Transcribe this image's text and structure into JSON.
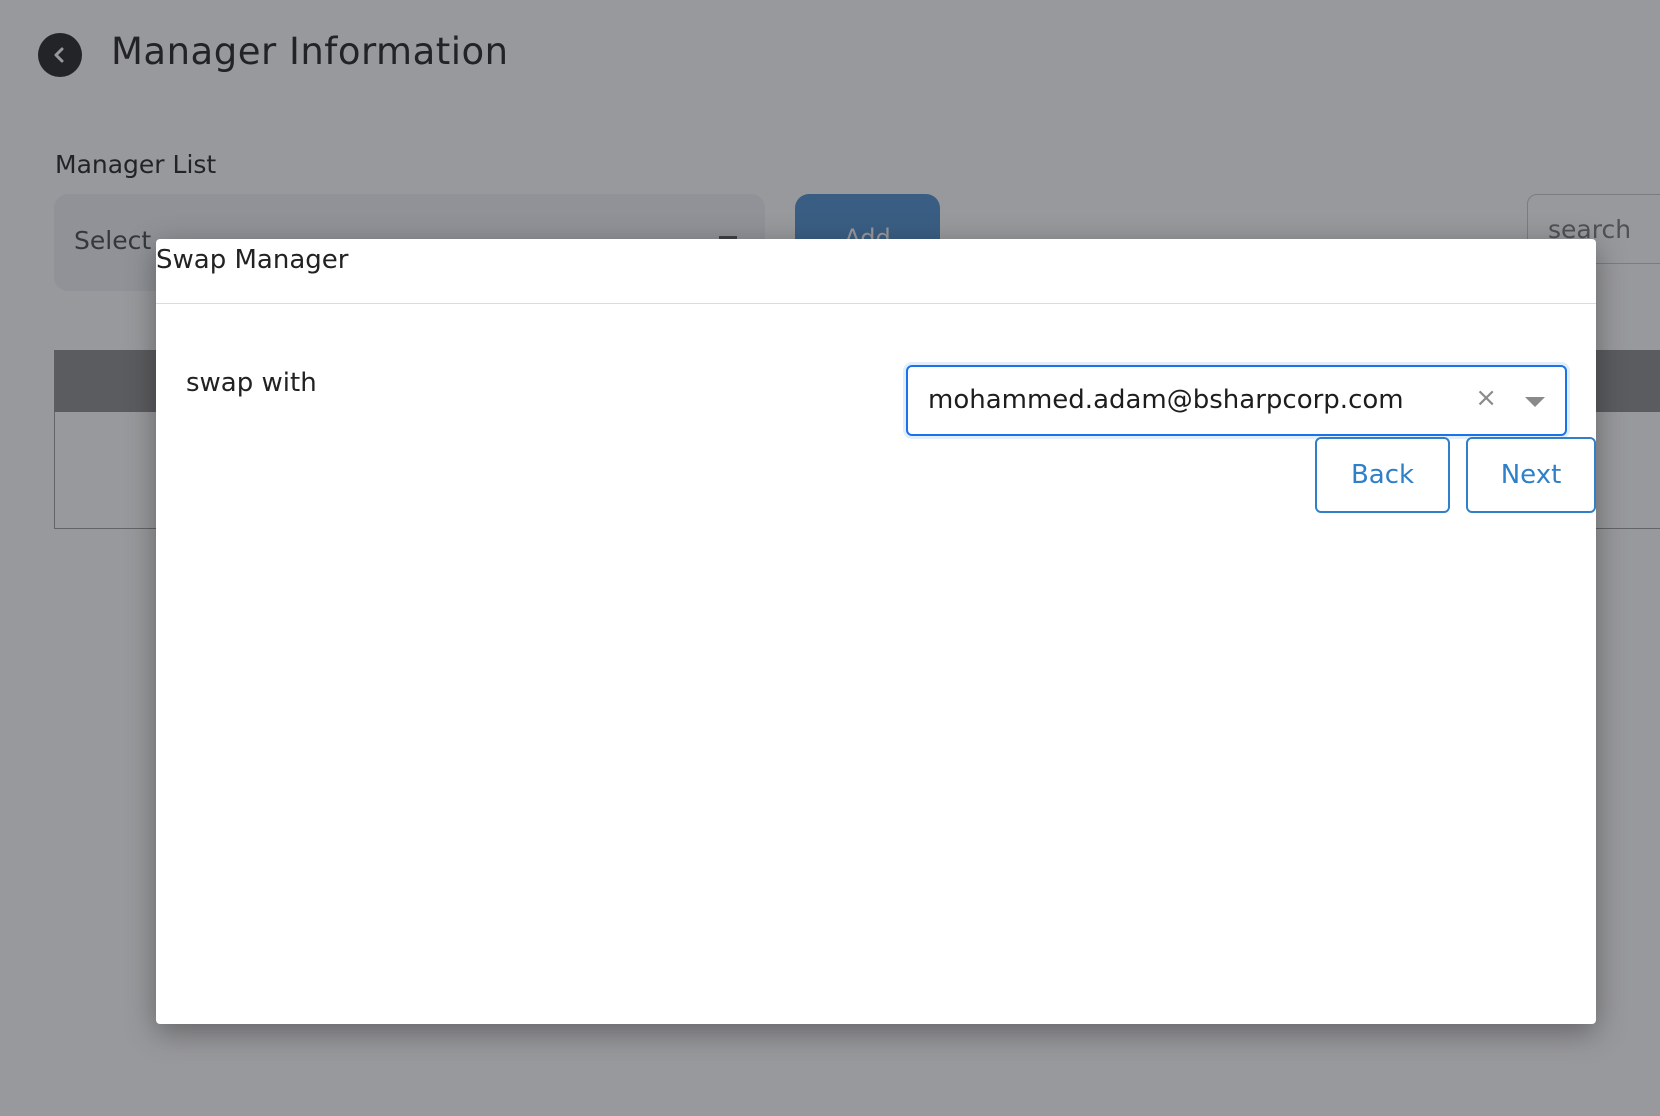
{
  "page": {
    "title": "Manager Information",
    "back_icon": "chevron-left-icon"
  },
  "manager_list": {
    "label": "Manager List",
    "select_placeholder": "Select",
    "add_button_label": "Add",
    "search_placeholder": "search"
  },
  "modal": {
    "title": "Swap Manager",
    "swap_label": "swap with",
    "swap_value": "mohammed.adam@bsharpcorp.com",
    "clear_icon": "×",
    "back_label": "Back",
    "next_label": "Next"
  },
  "colors": {
    "accent": "#2f80c8",
    "focus_border": "#1a73e8",
    "add_button": "#4b8fd0"
  }
}
